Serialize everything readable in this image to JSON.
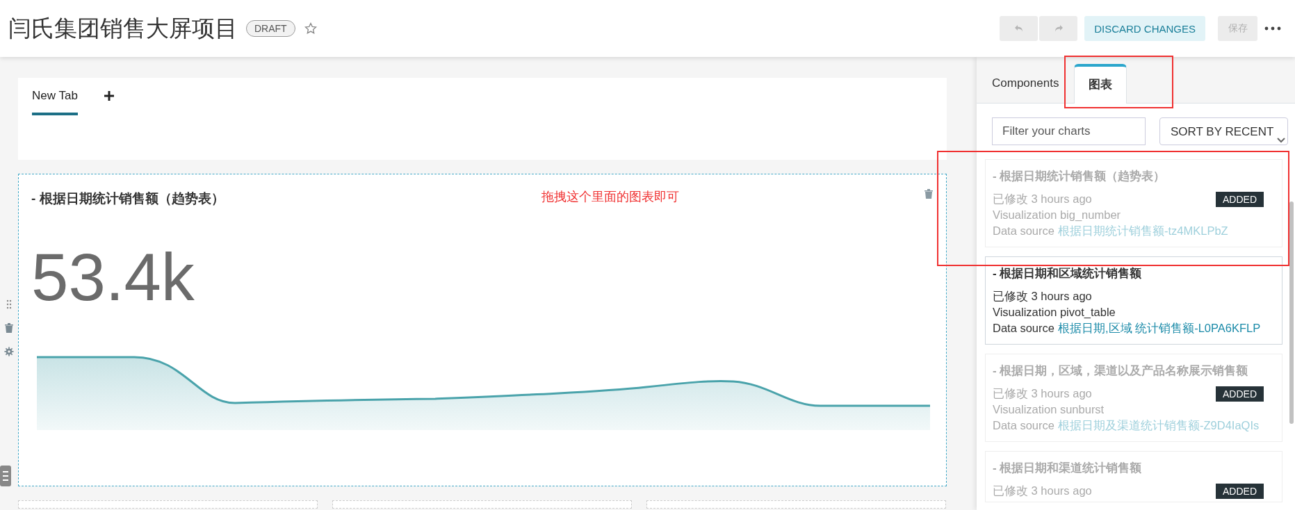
{
  "header": {
    "title": "闫氏集团销售大屏项目",
    "status_badge": "DRAFT",
    "starred": false,
    "discard_button": "DISCARD CHANGES",
    "save_button": {
      "label": "保存",
      "disabled": true
    }
  },
  "dashboard_tabs": [
    {
      "label": "New Tab",
      "selected": true
    }
  ],
  "chart_card": {
    "title": "- 根据日期统计销售额（趋势表）",
    "big_number": "53.4k"
  },
  "annotation": "拖拽这个里面的图表即可",
  "side_panel": {
    "tabs": [
      {
        "label": "Components",
        "selected": false
      },
      {
        "label": "图表",
        "selected": true
      }
    ],
    "filter": {
      "placeholder": "Filter your charts"
    },
    "sort": "SORT BY RECENT",
    "charts": [
      {
        "title": "- 根据日期统计销售额（趋势表）",
        "modified": "已修改 3 hours ago",
        "visualization": "Visualization big_number",
        "source_label": "Data source",
        "source": "根据日期统计销售额-tz4MKLPbZ",
        "added": true,
        "badge": "ADDED"
      },
      {
        "title": "- 根据日期和区域统计销售额",
        "modified": "已修改 3 hours ago",
        "visualization": "Visualization pivot_table",
        "source_label": "Data source",
        "source": "根据日期,区域 统计销售额-L0PA6KFLP",
        "added": false
      },
      {
        "title": "- 根据日期，区域，渠道以及产品名称展示销售额",
        "modified": "已修改 3 hours ago",
        "visualization": "Visualization sunburst",
        "source_label": "Data source",
        "source": "根据日期及渠道统计销售额-Z9D4IaQIs",
        "added": true,
        "badge": "ADDED"
      },
      {
        "title": "- 根据日期和渠道统计销售额",
        "modified": "已修改 3 hours ago",
        "added": true,
        "badge": "ADDED"
      }
    ]
  }
}
